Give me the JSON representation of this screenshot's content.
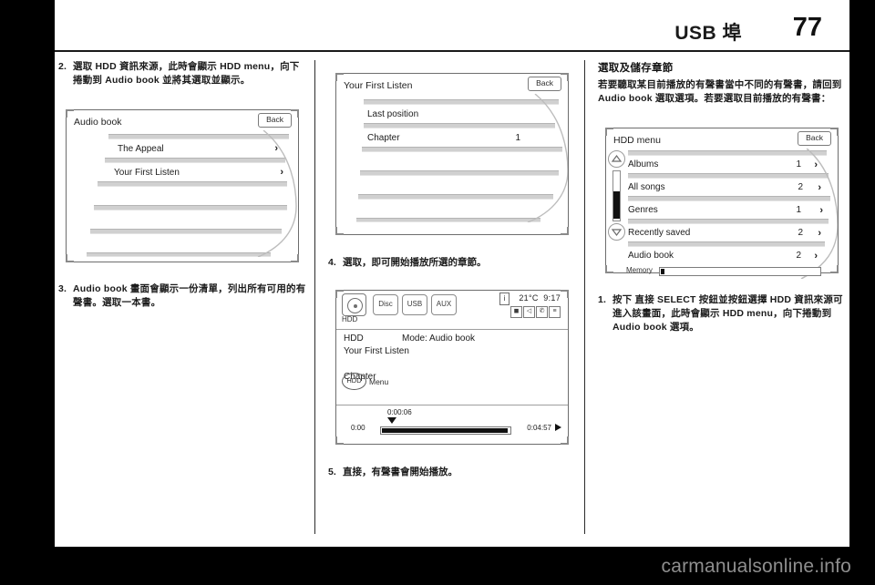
{
  "header": {
    "title": "USB 埠",
    "page_number": "77"
  },
  "column_left": {
    "step2": {
      "num": "2.",
      "text": "選取 HDD 資訊來源，此時會顯示 HDD menu，向下捲動到 Audio book 並將其選取並顯示。"
    },
    "screen_audio_book": {
      "title": "Audio book",
      "back_label": "Back",
      "rows": [
        {
          "label": "The Appeal",
          "chevron": "›"
        },
        {
          "label": "Your First Listen",
          "chevron": "›"
        }
      ]
    },
    "step3": {
      "num": "3.",
      "text": "Audio book 畫面會顯示一份清單，列出所有可用的有聲書。選取一本書。"
    }
  },
  "column_middle": {
    "screen_first_listen": {
      "title": "Your First Listen",
      "back_label": "Back",
      "rows": [
        {
          "label": "Last position",
          "value": ""
        },
        {
          "label": "Chapter",
          "value": "1"
        }
      ]
    },
    "step4": {
      "num": "4.",
      "text": "選取，即可開始播放所選的章節。"
    },
    "screen_player": {
      "sources": [
        "Disc",
        "USB",
        "AUX"
      ],
      "hdd_icon_label": "HDD",
      "temperature": "21°C",
      "clock": "9:17",
      "info_glyph": "i",
      "status_icons": [
        "mute-icon",
        "sound-icon",
        "phone-icon",
        "settings-icon"
      ],
      "source_line": "HDD",
      "mode_line": "Mode: Audio book",
      "track_title": "Your First Listen",
      "chapter_label": "Chapter",
      "knob_label": "HDD",
      "menu_label": "Menu",
      "elapsed": "0:00:06",
      "start_time": "0:00",
      "end_time": "0:04:57"
    },
    "step5": {
      "num": "5.",
      "text": "直接，有聲書會開始播放。"
    }
  },
  "column_right": {
    "section_title": "選取及儲存章節",
    "intro": "若要聽取某目前播放的有聲書當中不同的有聲書，請回到 Audio book 選取選項。若要選取目前播放的有聲書：",
    "screen_hdd_menu": {
      "title": "HDD menu",
      "back_label": "Back",
      "rows": [
        {
          "label": "Albums",
          "value": "1",
          "chevron": "›"
        },
        {
          "label": "All songs",
          "value": "2",
          "chevron": "›"
        },
        {
          "label": "Genres",
          "value": "1",
          "chevron": "›"
        },
        {
          "label": "Recently saved",
          "value": "2",
          "chevron": "›"
        },
        {
          "label": "Audio book",
          "value": "2",
          "chevron": "›"
        }
      ],
      "memory_label": "Memory",
      "scroll_up_icon": "triangle-up-icon",
      "scroll_down_icon": "triangle-down-icon"
    },
    "step1": {
      "num": "1.",
      "text": "按下 直接 SELECT 按鈕並按鈕選擇 HDD 資訊來源可進入該畫面，此時會顯示 HDD menu，向下捲動到 Audio book 選項。"
    }
  },
  "footer": {
    "watermark": "carmanualsonline.info"
  },
  "colors": {
    "page_background": "#000000",
    "paper": "#ffffff",
    "text": "#1b1b1b",
    "screen_border": "#6d6d6d",
    "row_rule": "#d0d0d0",
    "watermark": "#8e8e8e"
  }
}
